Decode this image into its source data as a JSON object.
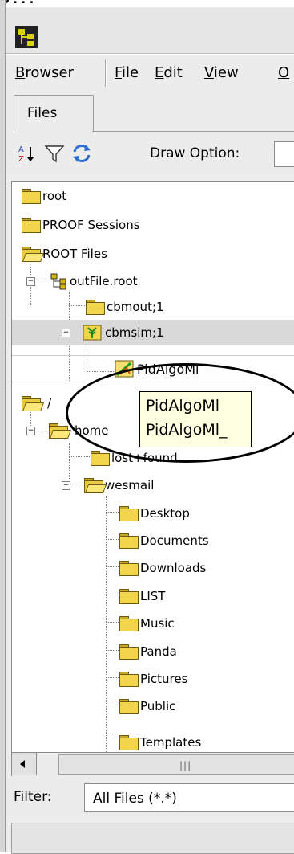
{
  "window": {
    "partial_title": "o . . ."
  },
  "menu": {
    "items": [
      {
        "label": "Browser",
        "ul": "B",
        "rest": "rowser"
      },
      {
        "label": "File",
        "ul": "F",
        "rest": "ile"
      },
      {
        "label": "Edit",
        "ul": "E",
        "rest": "dit"
      },
      {
        "label": "View",
        "ul": "V",
        "rest": "iew"
      },
      {
        "label": "O",
        "ul": "O",
        "rest": ""
      }
    ]
  },
  "tabs": {
    "files": "Files"
  },
  "toolbar": {
    "icons": [
      "sort-az-icon",
      "filter-funnel-icon",
      "refresh-icon"
    ],
    "draw_option_label": "Draw Option:",
    "draw_option_value": ""
  },
  "tree": {
    "nodes": [
      {
        "label": "root"
      },
      {
        "label": "PROOF Sessions"
      },
      {
        "label": "ROOT Files"
      },
      {
        "label": "outFile.root"
      },
      {
        "label": "cbmout;1"
      },
      {
        "label": "cbmsim;1"
      },
      {
        "label": "PidAlgoMl"
      },
      {
        "label": "/"
      },
      {
        "label": "home"
      },
      {
        "label": "lost+found"
      },
      {
        "label": "wesmail"
      },
      {
        "label": "Desktop"
      },
      {
        "label": "Documents"
      },
      {
        "label": "Downloads"
      },
      {
        "label": "LIST"
      },
      {
        "label": "Music"
      },
      {
        "label": "Panda"
      },
      {
        "label": "Pictures"
      },
      {
        "label": "Public"
      },
      {
        "label": "Templates"
      }
    ]
  },
  "tooltip": {
    "line1": "PidAlgoMl",
    "line2": "PidAlgoMl_"
  },
  "filter": {
    "label": "Filter:",
    "value": "All Files (*.*)"
  },
  "colors": {
    "folder": "#f1d64b",
    "tooltip_bg": "#ffffe1",
    "selection": "#d9d9d9"
  }
}
